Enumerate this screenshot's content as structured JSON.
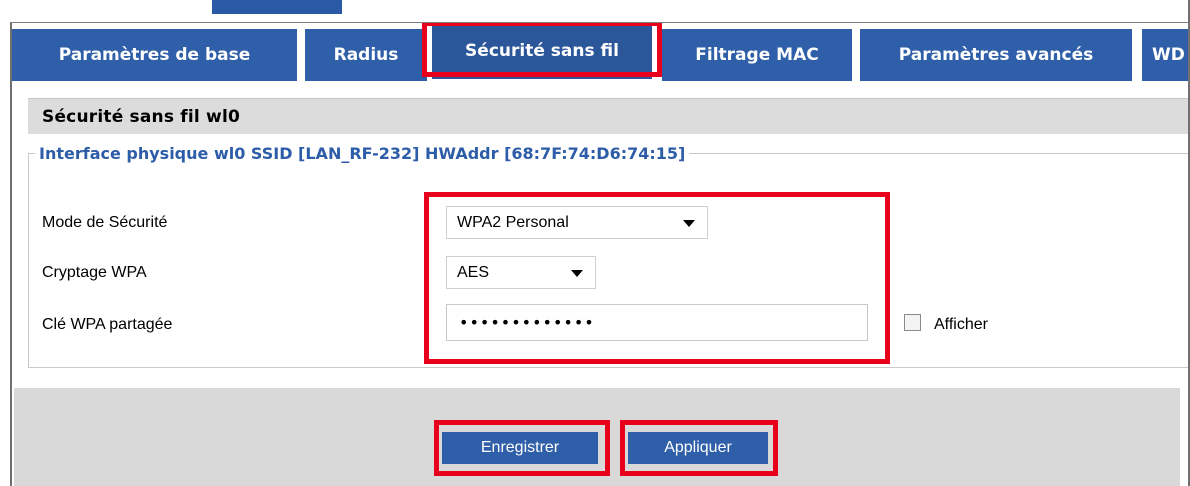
{
  "tabs": [
    {
      "label": "Paramètres de base",
      "active": false
    },
    {
      "label": "Radius",
      "active": false
    },
    {
      "label": "Sécurité sans fil",
      "active": true
    },
    {
      "label": "Filtrage MAC",
      "active": false
    },
    {
      "label": "Paramètres avancés",
      "active": false
    },
    {
      "label": "WD",
      "active": false
    }
  ],
  "section": {
    "title": "Sécurité sans fil wl0",
    "legend": "Interface physique wl0 SSID [LAN_RF-232] HWAddr [68:7F:74:D6:74:15]"
  },
  "form": {
    "security_mode": {
      "label": "Mode de Sécurité",
      "value": "WPA2 Personal"
    },
    "wpa_encryption": {
      "label": "Cryptage WPA",
      "value": "AES"
    },
    "shared_key": {
      "label": "Clé WPA partagée",
      "value": "•••••••••••••"
    },
    "show_key": {
      "label": "Afficher",
      "checked": false
    }
  },
  "buttons": {
    "save": "Enregistrer",
    "apply": "Appliquer"
  },
  "colors": {
    "tab_bg": "#2f5fa8",
    "legend_text": "#2d5ca8",
    "highlight": "#e8001c",
    "section_bg": "#dcdcdc",
    "footer_bg": "#d9d9d9"
  }
}
